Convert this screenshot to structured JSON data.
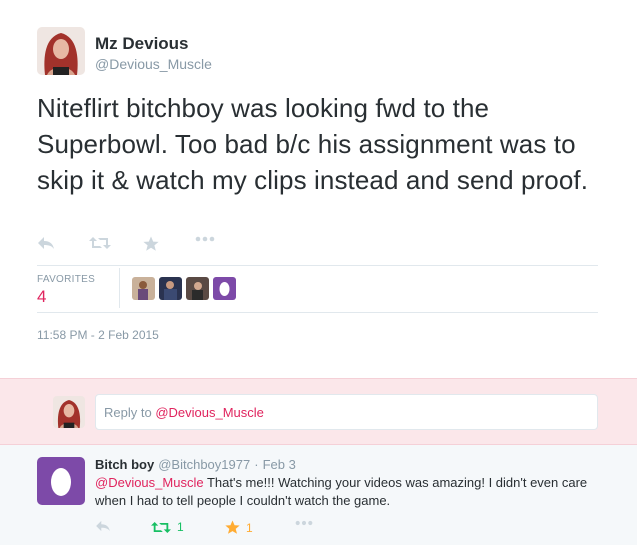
{
  "tweet": {
    "author_name": "Mz Devious",
    "author_handle": "@Devious_Muscle",
    "text": "Niteflirt bitchboy was looking fwd to the Superbowl. Too bad b/c his assignment was to skip it & watch my clips instead and send proof.",
    "favorites_label": "FAVORITES",
    "favorites_count": "4",
    "timestamp": "11:58 PM - 2 Feb 2015",
    "icons": [
      "reply-icon",
      "retweet-icon",
      "favorite-icon",
      "more-icon"
    ]
  },
  "reply_box": {
    "prefix": "Reply to ",
    "mention": "@Devious_Muscle"
  },
  "reply_tweet": {
    "author_name": "Bitch boy",
    "author_handle": "@Bitchboy1977",
    "date": "Feb 3",
    "mention": "@Devious_Muscle",
    "text": " That's me!!! Watching your videos was amazing! I didn't even care when I had to tell people I couldn't watch the game.",
    "retweet_count": "1",
    "favorite_count": "1"
  },
  "colors": {
    "accent": "#e0245e",
    "retweet_green": "#17bf63",
    "favorite_gold": "#ffac33",
    "muted": "#8899a6",
    "reply_bar_bg": "#fbe7ea"
  }
}
